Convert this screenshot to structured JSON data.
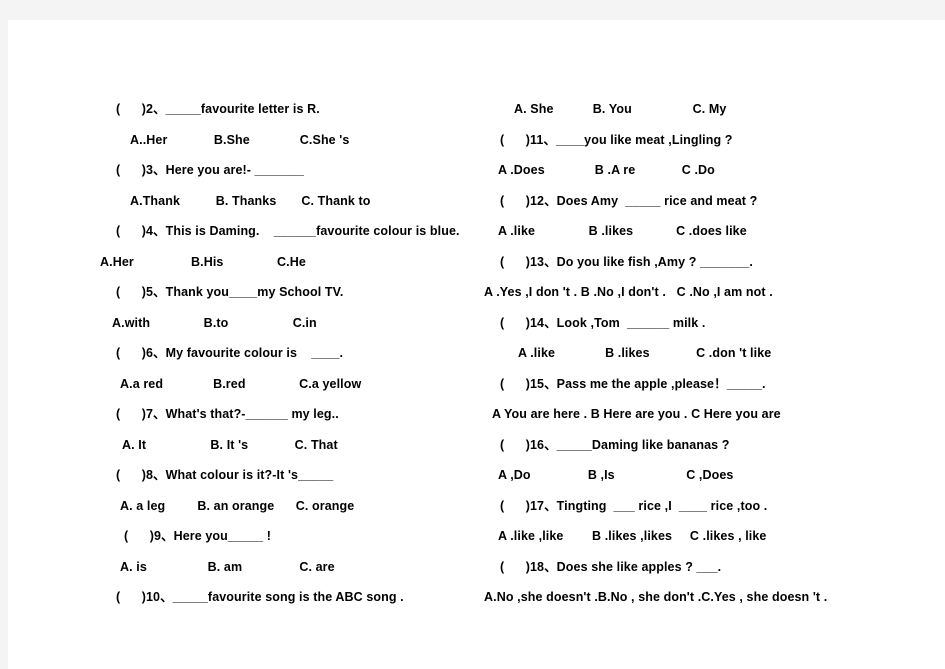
{
  "document": {
    "type": "worksheet",
    "subject": "English multiple-choice exercise",
    "page_background": "#ffffff",
    "outer_background": "#f4f4f4",
    "text_color": "#000000"
  },
  "left_column": {
    "lines": [
      {
        "id": "q2",
        "kind": "question",
        "text": "(      )2、_____favourite letter is R.",
        "indent": 16
      },
      {
        "id": "q2a",
        "kind": "options",
        "text": "A..Her             B.She              C.She 's",
        "indent": 30
      },
      {
        "id": "q3",
        "kind": "question",
        "text": "(      )3、Here you are!- _______",
        "indent": 16
      },
      {
        "id": "q3a",
        "kind": "options",
        "text": "A.Thank          B. Thanks       C. Thank to",
        "indent": 30
      },
      {
        "id": "q4",
        "kind": "question",
        "text": "(      )4、This is Daming.    ______favourite colour is blue.",
        "indent": 16
      },
      {
        "id": "q4a",
        "kind": "options",
        "text": "A.Her                B.His               C.He",
        "indent": 0
      },
      {
        "id": "q5",
        "kind": "question",
        "text": "(      )5、Thank you____my School TV.",
        "indent": 16
      },
      {
        "id": "q5a",
        "kind": "options",
        "text": "A.with               B.to                  C.in",
        "indent": 12
      },
      {
        "id": "q6",
        "kind": "question",
        "text": "(      )6、My favourite colour is    ____.",
        "indent": 16
      },
      {
        "id": "q6a",
        "kind": "options",
        "text": "A.a red              B.red               C.a yellow",
        "indent": 20
      },
      {
        "id": "q7",
        "kind": "question",
        "text": "(      )7、What's that?-______ my leg..",
        "indent": 16
      },
      {
        "id": "q7a",
        "kind": "options",
        "text": "A. It                  B. It 's             C. That",
        "indent": 22
      },
      {
        "id": "q8",
        "kind": "question",
        "text": "(      )8、What colour is it?-It 's_____",
        "indent": 16
      },
      {
        "id": "q8a",
        "kind": "options",
        "text": "A. a leg         B. an orange      C. orange",
        "indent": 20
      },
      {
        "id": "q9",
        "kind": "question",
        "text": "(      )9、Here you_____ !",
        "indent": 24
      },
      {
        "id": "q9a",
        "kind": "options",
        "text": "A. is                 B. am                C. are",
        "indent": 20
      },
      {
        "id": "q10",
        "kind": "question",
        "text": "(      )10、_____favourite song is the ABC song .",
        "indent": 16
      }
    ]
  },
  "right_column": {
    "lines": [
      {
        "id": "q10a",
        "kind": "options",
        "text": "A. She           B. You                 C. My",
        "indent": 30
      },
      {
        "id": "q11",
        "kind": "question",
        "text": "(      )11、____you like meat ,Lingling ?",
        "indent": 16
      },
      {
        "id": "q11a",
        "kind": "options",
        "text": "A .Does              B .A re             C .Do",
        "indent": 14
      },
      {
        "id": "q12",
        "kind": "question",
        "text": "(      )12、Does Amy  _____ rice and meat ?",
        "indent": 16
      },
      {
        "id": "q12a",
        "kind": "options",
        "text": "A .like               B .likes            C .does like",
        "indent": 14
      },
      {
        "id": "q13",
        "kind": "question",
        "text": "(      )13、Do you like fish ,Amy ? _______.",
        "indent": 16
      },
      {
        "id": "q13a",
        "kind": "options",
        "text": "A .Yes ,I don 't . B .No ,I don't .   C .No ,I am not .",
        "indent": 0
      },
      {
        "id": "q14",
        "kind": "question",
        "text": "(      )14、Look ,Tom  ______ milk .",
        "indent": 16
      },
      {
        "id": "q14a",
        "kind": "options",
        "text": "A .like              B .likes             C .don 't like",
        "indent": 34
      },
      {
        "id": "q15",
        "kind": "question",
        "text": "(      )15、Pass me the apple ,please！_____.",
        "indent": 16
      },
      {
        "id": "q15a",
        "kind": "options",
        "text": "A You are here . B Here are you . C Here you are",
        "indent": 8
      },
      {
        "id": "q16",
        "kind": "question",
        "text": "(      )16、_____Daming like bananas ?",
        "indent": 16
      },
      {
        "id": "q16a",
        "kind": "options",
        "text": "A ,Do                B ,Is                    C ,Does",
        "indent": 14
      },
      {
        "id": "q17",
        "kind": "question",
        "text": "(      )17、Tingting  ___ rice ,I  ____ rice ,too .",
        "indent": 16
      },
      {
        "id": "q17a",
        "kind": "options",
        "text": "A .like ,like        B .likes ,likes     C .likes , like",
        "indent": 14
      },
      {
        "id": "q18",
        "kind": "question",
        "text": "(      )18、Does she like apples ? ___.",
        "indent": 16
      },
      {
        "id": "q18a",
        "kind": "options",
        "text": "A.No ,she doesn't .B.No , she don't .C.Yes , she doesn 't .",
        "indent": 0
      }
    ]
  }
}
